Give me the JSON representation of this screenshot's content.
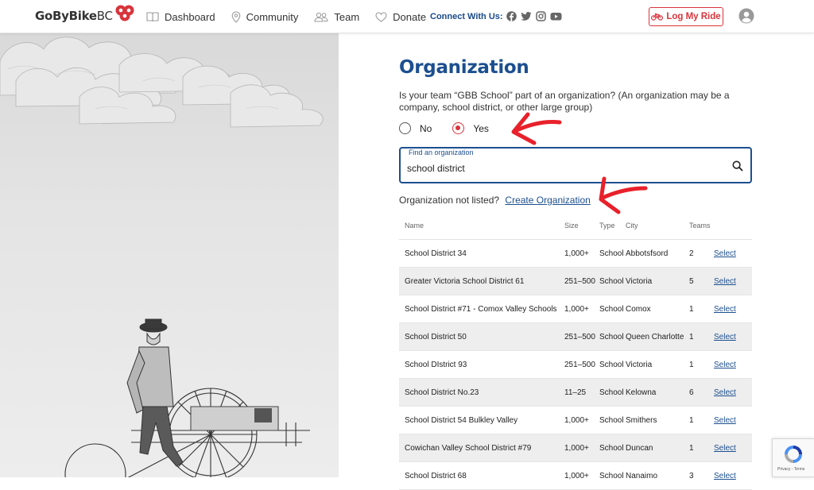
{
  "header": {
    "logo_main": "GoByBike",
    "logo_suffix": "BC",
    "nav": [
      {
        "label": "Dashboard",
        "icon": "book-icon"
      },
      {
        "label": "Community",
        "icon": "map-pin-icon"
      },
      {
        "label": "Team",
        "icon": "team-icon"
      },
      {
        "label": "Donate",
        "icon": "heart-icon"
      }
    ],
    "connect_label": "Connect With Us:",
    "socials": [
      "facebook-icon",
      "twitter-icon",
      "instagram-icon",
      "youtube-icon"
    ],
    "log_ride_label": "Log My Ride"
  },
  "colors": {
    "brand_blue": "#1c4f8f",
    "accent_red": "#d8343c",
    "annotation_red": "#e8212b"
  },
  "form": {
    "title": "Organization",
    "question": "Is your team “GBB School” part of an organization? (An organization may be a company, school district, or other large group)",
    "options": [
      {
        "label": "No",
        "selected": false
      },
      {
        "label": "Yes",
        "selected": true
      }
    ],
    "search_label": "Find an organization",
    "search_value": "school district",
    "not_listed_text": "Organization not listed?",
    "create_link": "Create Organization"
  },
  "table": {
    "headers": [
      "Name",
      "Size",
      "Type",
      "City",
      "Teams"
    ],
    "select_label": "Select",
    "rows": [
      {
        "name": "School District 34",
        "size": "1,000+",
        "type": "School",
        "city": "Abbotsfsord",
        "teams": "2"
      },
      {
        "name": "Greater Victoria School District 61",
        "size": "251–500",
        "type": "School",
        "city": "Victoria",
        "teams": "5"
      },
      {
        "name": "School District #71 - Comox Valley Schools",
        "size": "1,000+",
        "type": "School",
        "city": "Comox",
        "teams": "1"
      },
      {
        "name": "School District 50",
        "size": "251–500",
        "type": "School",
        "city": "Queen Charlotte",
        "teams": "1"
      },
      {
        "name": "School DIstrict 93",
        "size": "251–500",
        "type": "School",
        "city": "Victoria",
        "teams": "1"
      },
      {
        "name": "School District No.23",
        "size": "11–25",
        "type": "School",
        "city": "Kelowna",
        "teams": "6"
      },
      {
        "name": "School District 54 Bulkley Valley",
        "size": "1,000+",
        "type": "School",
        "city": "Smithers",
        "teams": "1"
      },
      {
        "name": "Cowichan Valley School District #79",
        "size": "1,000+",
        "type": "School",
        "city": "Duncan",
        "teams": "1"
      },
      {
        "name": "School District 68",
        "size": "1,000+",
        "type": "School",
        "city": "Nanaimo",
        "teams": "3"
      }
    ]
  },
  "recaptcha": {
    "text": "Privacy - Terms"
  }
}
